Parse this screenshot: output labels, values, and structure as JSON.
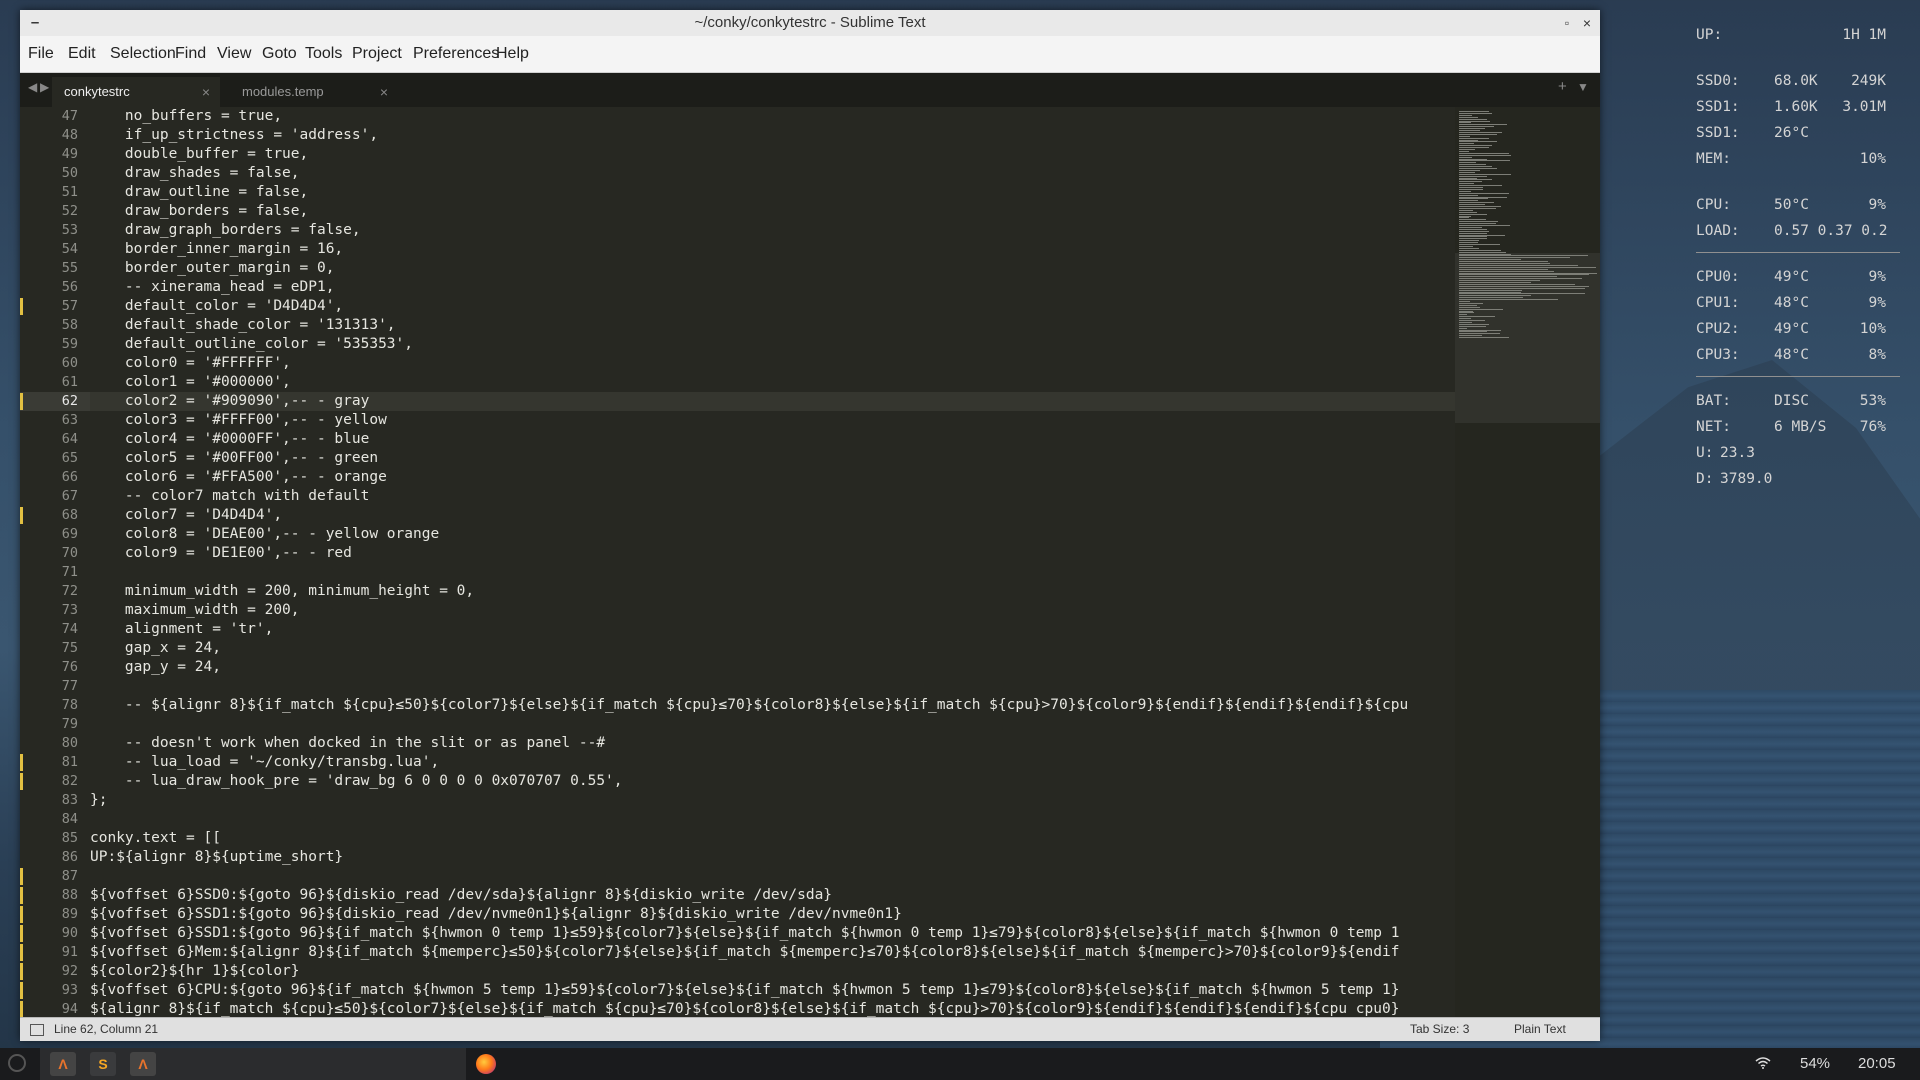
{
  "window": {
    "title": "~/conky/conkytestrc - Sublime Text",
    "controls": {
      "minimize": "–",
      "maximize": "▫",
      "close": "×"
    }
  },
  "menu": [
    "File",
    "Edit",
    "Selection",
    "Find",
    "View",
    "Goto",
    "Tools",
    "Project",
    "Preferences",
    "Help"
  ],
  "tabs": [
    {
      "label": "conkytestrc",
      "active": true
    },
    {
      "label": "modules.temp",
      "active": false
    }
  ],
  "tab_icons": {
    "prev": "◀",
    "next": "▶",
    "new_tab": "+",
    "tab_list": "▼",
    "close": "×"
  },
  "editor": {
    "current_line": 62,
    "lines": [
      {
        "n": 47,
        "text": "    no_buffers = true,",
        "mod": false
      },
      {
        "n": 48,
        "text": "    if_up_strictness = 'address',",
        "mod": false
      },
      {
        "n": 49,
        "text": "    double_buffer = true,",
        "mod": false
      },
      {
        "n": 50,
        "text": "    draw_shades = false,",
        "mod": false
      },
      {
        "n": 51,
        "text": "    draw_outline = false,",
        "mod": false
      },
      {
        "n": 52,
        "text": "    draw_borders = false,",
        "mod": false
      },
      {
        "n": 53,
        "text": "    draw_graph_borders = false,",
        "mod": false
      },
      {
        "n": 54,
        "text": "    border_inner_margin = 16,",
        "mod": false
      },
      {
        "n": 55,
        "text": "    border_outer_margin = 0,",
        "mod": false
      },
      {
        "n": 56,
        "text": "    -- xinerama_head = eDP1,",
        "mod": false
      },
      {
        "n": 57,
        "text": "    default_color = 'D4D4D4',",
        "mod": true
      },
      {
        "n": 58,
        "text": "    default_shade_color = '131313',",
        "mod": false
      },
      {
        "n": 59,
        "text": "    default_outline_color = '535353',",
        "mod": false
      },
      {
        "n": 60,
        "text": "    color0 = '#FFFFFF',",
        "mod": false
      },
      {
        "n": 61,
        "text": "    color1 = '#000000',",
        "mod": false
      },
      {
        "n": 62,
        "text": "    color2 = '#909090',-- - gray",
        "mod": true
      },
      {
        "n": 63,
        "text": "    color3 = '#FFFF00',-- - yellow",
        "mod": false
      },
      {
        "n": 64,
        "text": "    color4 = '#0000FF',-- - blue",
        "mod": false
      },
      {
        "n": 65,
        "text": "    color5 = '#00FF00',-- - green",
        "mod": false
      },
      {
        "n": 66,
        "text": "    color6 = '#FFA500',-- - orange",
        "mod": false
      },
      {
        "n": 67,
        "text": "    -- color7 match with default",
        "mod": false
      },
      {
        "n": 68,
        "text": "    color7 = 'D4D4D4',",
        "mod": true
      },
      {
        "n": 69,
        "text": "    color8 = 'DEAE00',-- - yellow orange",
        "mod": false
      },
      {
        "n": 70,
        "text": "    color9 = 'DE1E00',-- - red",
        "mod": false
      },
      {
        "n": 71,
        "text": "",
        "mod": false
      },
      {
        "n": 72,
        "text": "    minimum_width = 200, minimum_height = 0,",
        "mod": false
      },
      {
        "n": 73,
        "text": "    maximum_width = 200,",
        "mod": false
      },
      {
        "n": 74,
        "text": "    alignment = 'tr',",
        "mod": false
      },
      {
        "n": 75,
        "text": "    gap_x = 24,",
        "mod": false
      },
      {
        "n": 76,
        "text": "    gap_y = 24,",
        "mod": false
      },
      {
        "n": 77,
        "text": "",
        "mod": false
      },
      {
        "n": 78,
        "text": "    -- ${alignr 8}${if_match ${cpu}≤50}${color7}${else}${if_match ${cpu}≤70}${color8}${else}${if_match ${cpu}>70}${color9}${endif}${endif}${endif}${cpu",
        "mod": false
      },
      {
        "n": 79,
        "text": "",
        "mod": false
      },
      {
        "n": 80,
        "text": "    -- doesn't work when docked in the slit or as panel --#",
        "mod": false
      },
      {
        "n": 81,
        "text": "    -- lua_load = '~/conky/transbg.lua',",
        "mod": true
      },
      {
        "n": 82,
        "text": "    -- lua_draw_hook_pre = 'draw_bg 6 0 0 0 0 0x070707 0.55',",
        "mod": true
      },
      {
        "n": 83,
        "text": "};",
        "mod": false
      },
      {
        "n": 84,
        "text": "",
        "mod": false
      },
      {
        "n": 85,
        "text": "conky.text = [[",
        "mod": false
      },
      {
        "n": 86,
        "text": "UP:${alignr 8}${uptime_short}",
        "mod": false
      },
      {
        "n": 87,
        "text": "",
        "mod": true
      },
      {
        "n": 88,
        "text": "${voffset 6}SSD0:${goto 96}${diskio_read /dev/sda}${alignr 8}${diskio_write /dev/sda}",
        "mod": true
      },
      {
        "n": 89,
        "text": "${voffset 6}SSD1:${goto 96}${diskio_read /dev/nvme0n1}${alignr 8}${diskio_write /dev/nvme0n1}",
        "mod": true
      },
      {
        "n": 90,
        "text": "${voffset 6}SSD1:${goto 96}${if_match ${hwmon 0 temp 1}≤59}${color7}${else}${if_match ${hwmon 0 temp 1}≤79}${color8}${else}${if_match ${hwmon 0 temp 1",
        "mod": true
      },
      {
        "n": 91,
        "text": "${voffset 6}Mem:${alignr 8}${if_match ${memperc}≤50}${color7}${else}${if_match ${memperc}≤70}${color8}${else}${if_match ${memperc}>70}${color9}${endif",
        "mod": true
      },
      {
        "n": 92,
        "text": "${color2}${hr 1}${color}",
        "mod": true
      },
      {
        "n": 93,
        "text": "${voffset 6}CPU:${goto 96}${if_match ${hwmon 5 temp 1}≤59}${color7}${else}${if_match ${hwmon 5 temp 1}≤79}${color8}${else}${if_match ${hwmon 5 temp 1}",
        "mod": true
      },
      {
        "n": 94,
        "text": "${alignr 8}${if_match ${cpu}≤50}${color7}${else}${if_match ${cpu}≤70}${color8}${else}${if_match ${cpu}>70}${color9}${endif}${endif}${endif}${cpu cpu0}",
        "mod": true
      }
    ]
  },
  "status": {
    "position": "Line 62, Column 21",
    "tab_size": "Tab Size: 3",
    "syntax": "Plain Text"
  },
  "conky": {
    "groups": [
      [
        {
          "label": "UP:",
          "mid": "",
          "right": "1H 1M"
        }
      ],
      [
        {
          "label": "SSD0:",
          "mid": "68.0K",
          "right": "249K"
        },
        {
          "label": "SSD1:",
          "mid": "1.60K",
          "right": "3.01M"
        },
        {
          "label": "SSD1:",
          "mid": "26°C",
          "right": ""
        },
        {
          "label": "MEM:",
          "mid": "",
          "right": "10%"
        }
      ],
      [
        {
          "label": "CPU:",
          "mid": "50°C",
          "right": "9%"
        },
        {
          "label": "LOAD:",
          "mid": "0.57 0.37 0.2",
          "right": ""
        }
      ],
      [
        {
          "label": "CPU0:",
          "mid": "49°C",
          "right": "9%"
        },
        {
          "label": "CPU1:",
          "mid": "48°C",
          "right": "9%"
        },
        {
          "label": "CPU2:",
          "mid": "49°C",
          "right": "10%"
        },
        {
          "label": "CPU3:",
          "mid": "48°C",
          "right": "8%"
        }
      ],
      [
        {
          "label": "BAT:",
          "mid": "DISC",
          "right": "53%"
        },
        {
          "label": "NET:",
          "mid": "6 MB/S",
          "right": "76%"
        },
        {
          "label": "U:",
          "mid": "23.3",
          "right": ""
        },
        {
          "label": "D:",
          "mid": "3789.0",
          "right": ""
        }
      ]
    ]
  },
  "taskbar": {
    "apps": [
      {
        "name": "terminal-a-icon",
        "glyph": "Λ",
        "color": "#e8732c"
      },
      {
        "name": "sublime-text-icon",
        "glyph": "S",
        "color": "#f5a623"
      },
      {
        "name": "terminal-b-icon",
        "glyph": "Λ",
        "color": "#e8732c"
      }
    ],
    "wifi_icon": "wifi-icon",
    "battery": "54%",
    "clock": "20:05"
  }
}
